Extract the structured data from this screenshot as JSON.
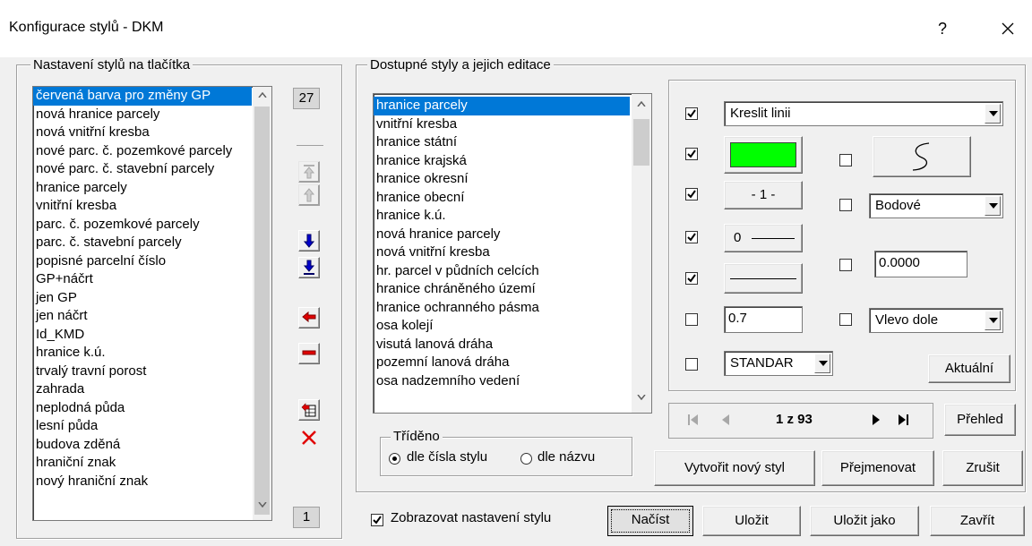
{
  "window": {
    "title": "Konfigurace stylů - DKM",
    "help_label": "?"
  },
  "left_group": {
    "title": "Nastavení stylů na tlačítka",
    "items": [
      "červená barva pro změny GP",
      "nová hranice parcely",
      "nová vnitřní kresba",
      "nové parc. č. pozemkové parcely",
      "nové parc. č. stavební parcely",
      "hranice parcely",
      "vnitřní kresba",
      "parc. č. pozemkové parcely",
      "parc. č. stavební parcely",
      "popisné parcelní číslo",
      "GP+náčrt",
      "jen GP",
      "jen náčrt",
      "Id_KMD",
      "hranice k.ú.",
      "trvalý travní porost",
      "zahrada",
      "neplodná půda",
      "lesní půda",
      "budova zděná",
      "hraniční znak",
      "nový hraniční znak"
    ],
    "selected_index": 0,
    "top_count": "27",
    "bottom_count": "1"
  },
  "right_group": {
    "title": "Dostupné styly a jejich editace",
    "items": [
      "hranice parcely",
      "vnitřní kresba",
      "hranice státní",
      "hranice krajská",
      "hranice okresní",
      "hranice obecní",
      "hranice k.ú.",
      "nová hranice parcely",
      "nová vnitřní kresba",
      "hr. parcel v půdních celcích",
      "hranice chráněného území",
      "hranice ochranného pásma",
      "osa kolejí",
      "visutá lanová dráha",
      "pozemní lanová dráha",
      "osa nadzemního vedení"
    ],
    "selected_index": 0,
    "sort": {
      "title": "Tříděno",
      "by_number": "dle čísla stylu",
      "by_name": "dle názvu",
      "selected": "by_number"
    }
  },
  "editor": {
    "draw_line": {
      "checked": true,
      "value": "Kreslit linii"
    },
    "color": {
      "checked": true,
      "value": "#00ff00"
    },
    "curve_checked": false,
    "line_number": {
      "checked": true,
      "label": "- 1 -"
    },
    "point_mode": {
      "checked": false,
      "value": "Bodové"
    },
    "width": {
      "checked": true,
      "label": "0"
    },
    "line_style": {
      "checked": true
    },
    "angle": {
      "checked": false,
      "value": "0.0000"
    },
    "size": {
      "checked": false,
      "value": "0.7"
    },
    "position": {
      "checked": false,
      "value": "Vlevo dole"
    },
    "font": {
      "checked": false,
      "value": "STANDAR"
    },
    "apply_label": "Aktuální"
  },
  "navigation": {
    "position": "1 z 93",
    "overview_label": "Přehled"
  },
  "style_actions": {
    "create": "Vytvořit nový styl",
    "rename": "Přejmenovat",
    "delete": "Zrušit"
  },
  "footer": {
    "show_settings": {
      "checked": true,
      "label": "Zobrazovat nastavení stylu"
    },
    "load": "Načíst",
    "save": "Uložit",
    "save_as": "Uložit jako",
    "close": "Zavřít"
  }
}
